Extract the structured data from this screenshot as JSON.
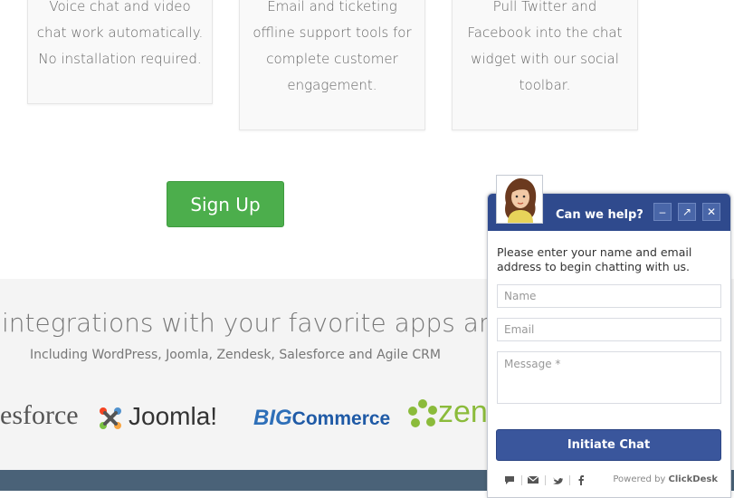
{
  "features": [
    {
      "lines": [
        "Voice chat and video",
        "chat work automatically.",
        "No installation required."
      ]
    },
    {
      "lines": [
        "Email and ticketing",
        "offline support tools for",
        "complete customer",
        "engagement."
      ]
    },
    {
      "lines": [
        "Pull Twitter and",
        "Facebook into the chat",
        "widget with our social",
        "toolbar."
      ]
    }
  ],
  "signup_label": "Sign Up",
  "integrations": {
    "title": "integrations with your favorite apps and p",
    "subtitle": "Including WordPress, Joomla, Zendesk, Salesforce and Agile CRM",
    "logos": {
      "salesforce": "esforce",
      "joomla": "Joomla!",
      "big_part": "BIG",
      "commerce_part": "Commerce",
      "zendesk": "zen"
    }
  },
  "chat": {
    "title": "Can we help?",
    "intro": "Please enter your name and email address to begin chatting with us.",
    "name_placeholder": "Name",
    "email_placeholder": "Email",
    "message_placeholder": "Message *",
    "button_label": "Initiate Chat",
    "powered_prefix": "Powered by",
    "powered_brand": "ClickDesk",
    "header_buttons": {
      "minimize": "–",
      "popout": "↗",
      "close": "✕"
    }
  },
  "colors": {
    "signup_green": "#4cae4c",
    "chat_header": "#2f4a8d",
    "chat_button": "#3a569c",
    "footer_bar": "#4a6278"
  },
  "icons": [
    "chat-icon",
    "email-icon",
    "twitter-icon",
    "facebook-icon"
  ]
}
